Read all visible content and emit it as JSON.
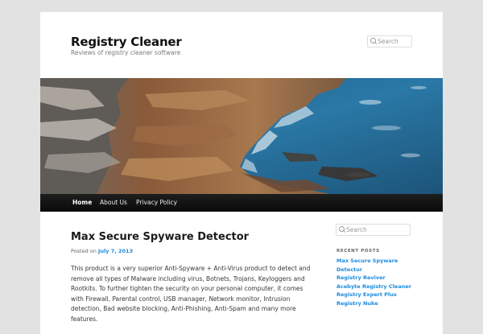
{
  "site": {
    "title": "Registry Cleaner",
    "description": "Reviews of registry cleaner software"
  },
  "header_search": {
    "placeholder": "Search"
  },
  "nav": {
    "items": [
      {
        "label": "Home",
        "current": true
      },
      {
        "label": "About Us",
        "current": false
      },
      {
        "label": "Privacy Policy",
        "current": false
      }
    ]
  },
  "post": {
    "title": "Max Secure Spyware Detector",
    "posted_on_label": "Posted on",
    "date": "July 7, 2013",
    "body_lines": [
      "This product is a very superior Anti-Spyware + Anti-Virus product to detect and",
      "remove all types of Malware including virus, Botnets, Trojans, Keyloggers and",
      "Rootkits. To further tighten the security on your personal computer, it comes",
      "with Firewall, Parental control, USB manager, Network monitor, Intrusion",
      "detection, Bad website blocking, Anti-Phishing, Anti-Spam and many more",
      "features."
    ]
  },
  "sidebar": {
    "search": {
      "placeholder": "Search"
    },
    "recent_posts": {
      "heading": "Recent Posts",
      "items": [
        {
          "lines": [
            "Max Secure Spyware",
            "Detector"
          ]
        },
        {
          "lines": [
            "Registry Reviver"
          ]
        },
        {
          "lines": [
            "Acebyte Registry Cleaner"
          ]
        },
        {
          "lines": [
            "Registry Expert Plus"
          ]
        },
        {
          "lines": [
            "Registry Nuke"
          ]
        }
      ]
    }
  },
  "colors": {
    "page_bg": "#e2e2e2",
    "link": "#1b8be0",
    "nav_bg": "#111111"
  }
}
